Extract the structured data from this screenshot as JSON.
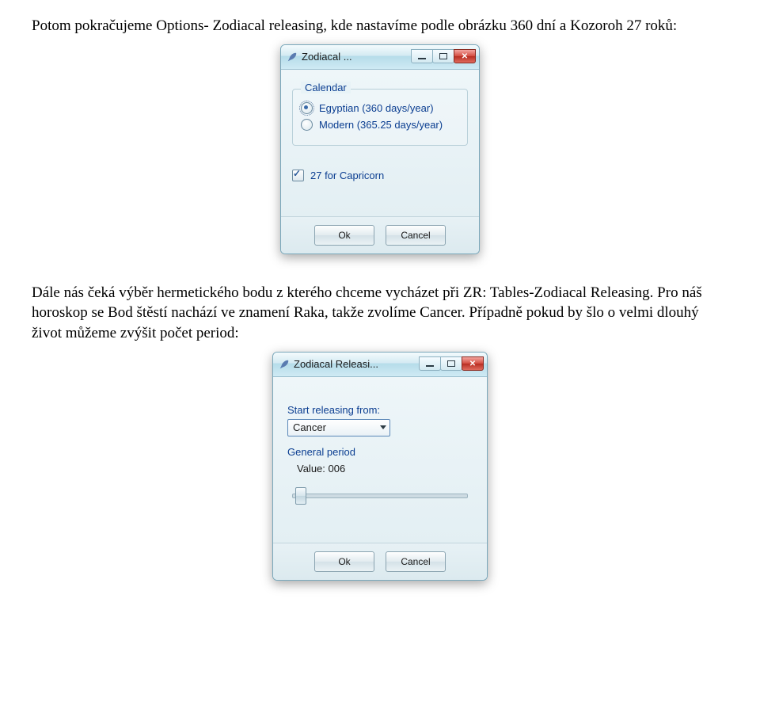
{
  "para1": "Potom pokračujeme Options- Zodiacal releasing, kde nastavíme podle obrázku 360 dní a Kozoroh 27 roků:",
  "para2": "Dále nás čeká výběr hermetického bodu z kterého chceme vycházet při ZR: Tables-Zodiacal Releasing. Pro náš horoskop se Bod štěstí nachází ve znamení Raka, takže zvolíme Cancer. Případně pokud by šlo o velmi dlouhý život můžeme zvýšit počet period:",
  "dialog1": {
    "title": "Zodiacal ...",
    "group_legend": "Calendar",
    "radio1": "Egyptian (360 days/year)",
    "radio2": "Modern (365.25 days/year)",
    "checkbox_label": "27 for Capricorn",
    "ok": "Ok",
    "cancel": "Cancel"
  },
  "dialog2": {
    "title": "Zodiacal Releasi...",
    "start_label": "Start releasing from:",
    "combo_value": "Cancer",
    "general_period_label": "General period",
    "value_label": "Value: 006",
    "ok": "Ok",
    "cancel": "Cancel"
  }
}
